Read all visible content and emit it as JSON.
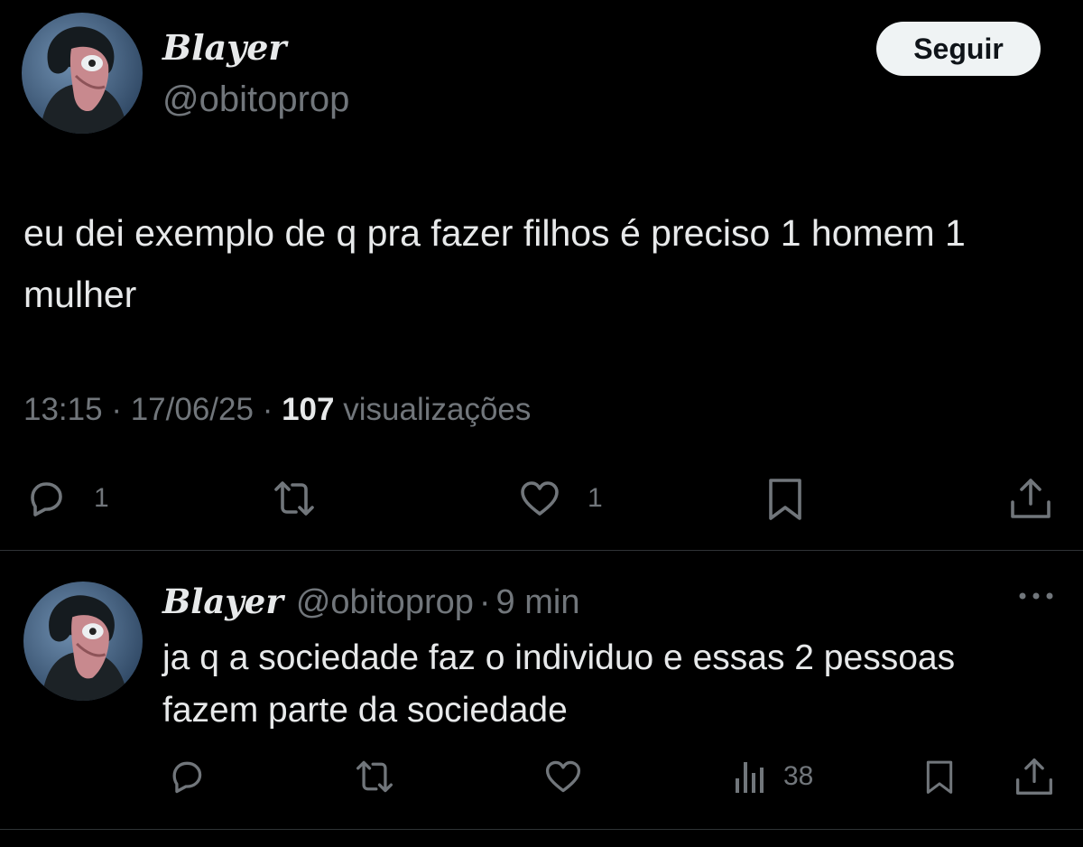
{
  "main_tweet": {
    "author_name": "Blayer",
    "author_handle": "@obitoprop",
    "follow_label": "Seguir",
    "text": "eu dei exemplo de q pra fazer filhos é preciso 1 homem 1 mulher",
    "time": "13:15",
    "separator": "·",
    "date": "17/06/25",
    "views_count": "107",
    "views_label": "visualizações",
    "actions": {
      "reply_icon": "reply-icon",
      "reply_count": "1",
      "retweet_icon": "retweet-icon",
      "like_icon": "heart-icon",
      "like_count": "1",
      "bookmark_icon": "bookmark-icon",
      "share_icon": "share-icon"
    }
  },
  "reply": {
    "author_name": "Blayer",
    "author_handle": "@obitoprop",
    "separator": "·",
    "time_ago": "9 min",
    "text": "ja q a sociedade faz o individuo e essas 2 pessoas fazem parte da sociedade",
    "more_icon": "more-options-icon",
    "actions": {
      "reply_icon": "reply-icon",
      "retweet_icon": "retweet-icon",
      "like_icon": "heart-icon",
      "views_icon": "analytics-icon",
      "views_count": "38",
      "bookmark_icon": "bookmark-icon",
      "share_icon": "share-icon"
    }
  },
  "colors": {
    "background": "#000000",
    "text_primary": "#e7e9ea",
    "text_secondary": "#71767b",
    "divider": "#2f3336",
    "follow_button_bg": "#eff3f4"
  }
}
